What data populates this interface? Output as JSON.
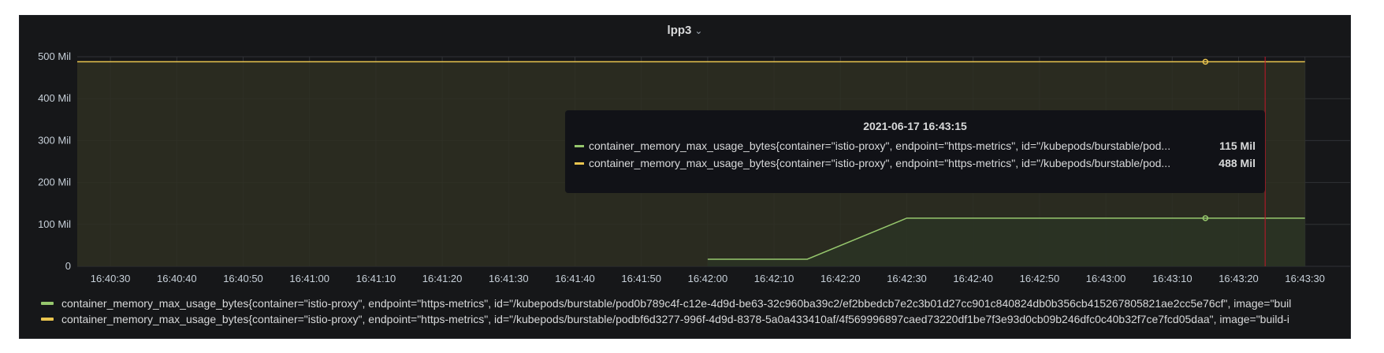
{
  "panel": {
    "title": "lpp3",
    "chevron": "⌄"
  },
  "colors": {
    "series1": "#96c76d",
    "series2": "#eac54f",
    "now_marker": "#c4162a",
    "grid": "#303236",
    "fill1": "#2a3425",
    "fill2": "#2e2f22"
  },
  "chart_data": {
    "type": "line",
    "x_ticks": [
      "16:40:30",
      "16:40:40",
      "16:40:50",
      "16:41:00",
      "16:41:10",
      "16:41:20",
      "16:41:30",
      "16:41:40",
      "16:41:50",
      "16:42:00",
      "16:42:10",
      "16:42:20",
      "16:42:30",
      "16:42:40",
      "16:42:50",
      "16:43:00",
      "16:43:10",
      "16:43:20",
      "16:43:30"
    ],
    "x_range": [
      "16:40:25",
      "16:43:30"
    ],
    "y_ticks": [
      "0",
      "100 Mil",
      "200 Mil",
      "300 Mil",
      "400 Mil",
      "500 Mil"
    ],
    "ylim": [
      0,
      500
    ],
    "y_unit": "Mil",
    "series": [
      {
        "name": "container_memory_max_usage_bytes{container=\"istio-proxy\", endpoint=\"https-metrics\", id=\"/kubepods/burstable/pod0b789c4f-c12e-4d9d-be63-32c960ba39c2/ef2bbedcb7e2c3b01d27cc901c840824db0b356cb415267805821ae2cc5e76cf\", image=\"buil",
        "color": "#96c76d",
        "points": [
          [
            "16:42:00",
            17
          ],
          [
            "16:42:15",
            17
          ],
          [
            "16:42:30",
            115
          ],
          [
            "16:43:30",
            115
          ]
        ]
      },
      {
        "name": "container_memory_max_usage_bytes{container=\"istio-proxy\", endpoint=\"https-metrics\", id=\"/kubepods/burstable/podbf6d3277-996f-4d9d-8378-5a0a433410af/4f569996897caed73220df1be7f3e93d0cb09b246dfc0c40b32f7ce7fcd05daa\", image=\"build-i",
        "color": "#eac54f",
        "points": [
          [
            "16:40:25",
            488
          ],
          [
            "16:43:30",
            488
          ]
        ]
      }
    ],
    "hover_time": "16:43:15",
    "now_time": "16:43:24"
  },
  "tooltip": {
    "time": "2021-06-17 16:43:15",
    "rows": [
      {
        "name": "container_memory_max_usage_bytes{container=\"istio-proxy\", endpoint=\"https-metrics\", id=\"/kubepods/burstable/pod...",
        "value": "115 Mil"
      },
      {
        "name": "container_memory_max_usage_bytes{container=\"istio-proxy\", endpoint=\"https-metrics\", id=\"/kubepods/burstable/pod...",
        "value": "488 Mil"
      }
    ]
  }
}
